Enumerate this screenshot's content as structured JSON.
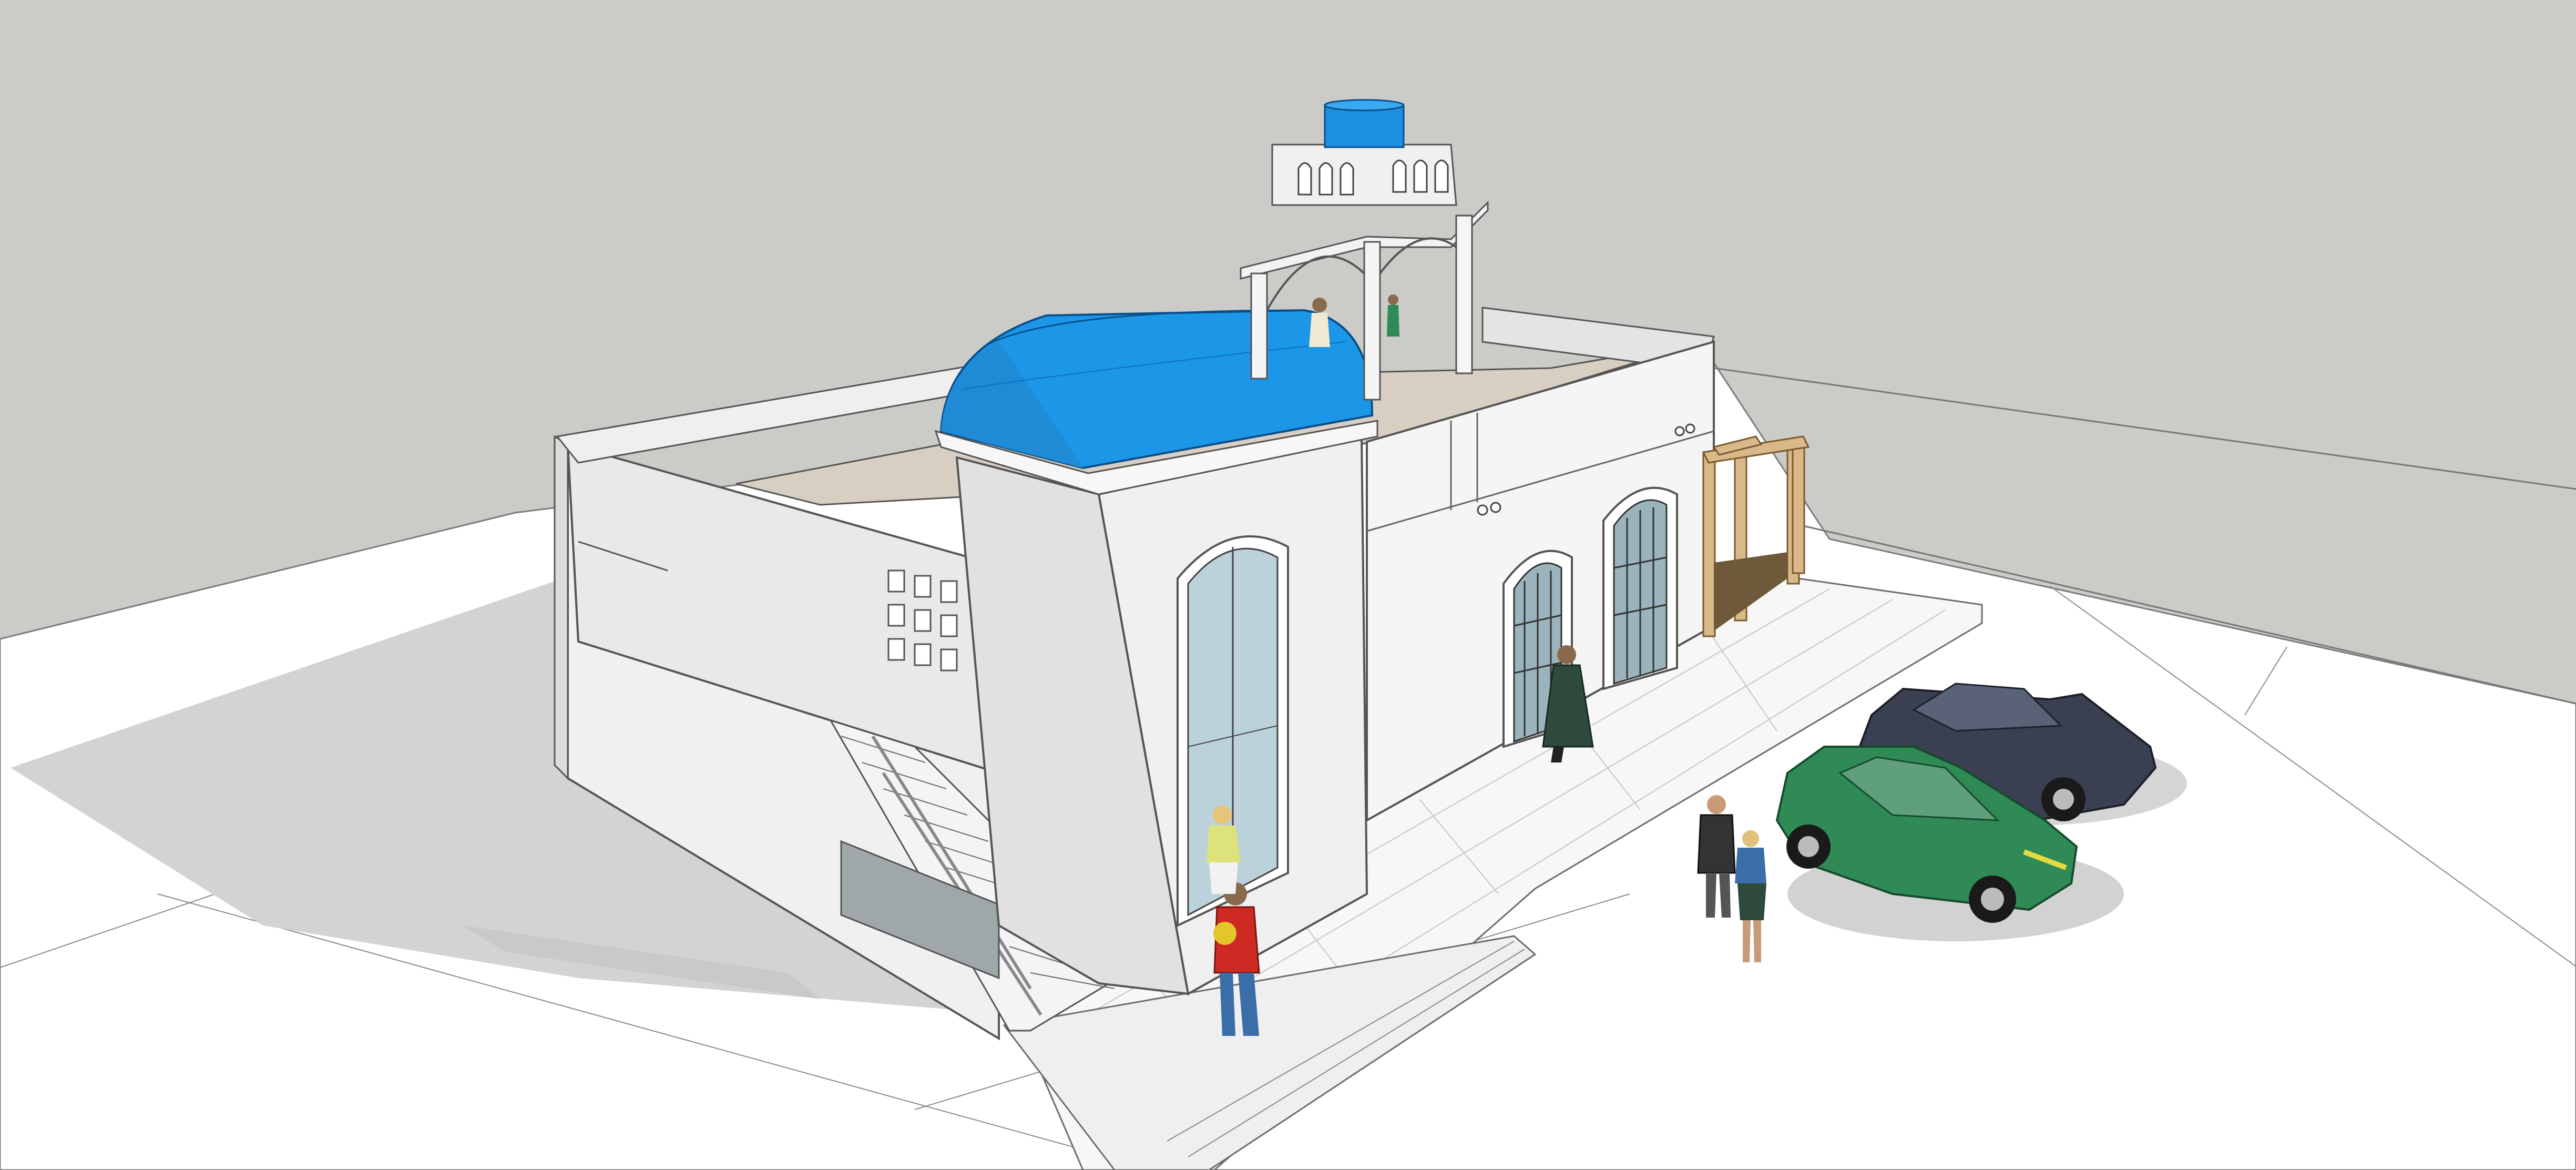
{
  "app": {
    "viewport_label": ""
  },
  "scene": {
    "background_color": "#cbcbc7",
    "ground_color": "#ffffff",
    "shadow_color": "#d2d2d2",
    "wall_color": "#f1f1f1",
    "wall_shade_color": "#e3e3e3",
    "dome_color": "#1c97e8",
    "dome_dark_color": "#0f6fc0",
    "water_tank_color": "#1c8fe0",
    "glass_color": "#bfd4dc",
    "pergola_color": "#d9b98a",
    "pavement_color": "#f6f6f6",
    "car_green_color": "#2f8a56",
    "car_navy_color": "#3a3f52",
    "person_red_color": "#cc2a22",
    "person_green_color": "#2d4a3c",
    "person_blue_color": "#3b6ea8",
    "icons": {
      "tower": "bell-tower-icon",
      "dome": "dome-icon",
      "tank": "water-tank-icon",
      "door": "arched-door-icon",
      "stairs": "staircase-icon",
      "car": "car-icon",
      "person": "person-icon",
      "pergola": "pergola-icon"
    }
  }
}
